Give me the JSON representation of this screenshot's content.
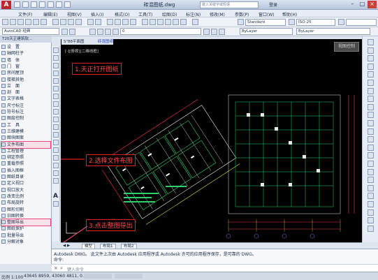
{
  "titlebar": {
    "document_title": "砖混图纸.dwg",
    "search_placeholder": "键入关键字或短语",
    "login_label": "登录",
    "minimize_icon": "minimize-icon",
    "maximize_icon": "maximize-icon",
    "close_icon": "close-icon"
  },
  "menubar": {
    "items": [
      "文件(F)",
      "编辑(E)",
      "视图(V)",
      "插入(I)",
      "格式(O)",
      "工具(T)",
      "绘图(D)",
      "标注(N)",
      "修改(M)",
      "参数(P)",
      "窗口(W)",
      "帮助(H)"
    ]
  },
  "toolbar1": {
    "style_value": "Standard",
    "dim_style_value": "ISO-25"
  },
  "toolbar2": {
    "workspace_value": "AutoCAD 经典",
    "layer_value": "0",
    "color_value": "ByLayer",
    "linetype_value": "ByLayer"
  },
  "left_panel": {
    "title": "T20天正建筑软...",
    "items": [
      "设　置",
      "轴网柱子",
      "墙　体",
      "门　窗",
      "房间屋顶",
      "楼梯其他",
      "立　面",
      "剖　面",
      "文字表格",
      "尺寸标注",
      "符号标注",
      "图层控制",
      "工　具",
      "三维建模",
      "图块图案",
      "文件布图",
      "工程管理",
      "绑定参照",
      "重载参照",
      "插入图框",
      "图纸目录",
      "定义视口",
      "视口放大",
      "改变比例",
      "布局旋转",
      "图形切割",
      "旧图转换",
      "整图导出",
      "图纸保护",
      "批量导出",
      "分解对象"
    ],
    "highlighted": [
      "文件布图",
      "整图导出"
    ]
  },
  "canvas": {
    "drawing_tab_label": "S\"88平面图",
    "drawing_tab_alt": "砖混图纸",
    "view_label": "[-][俯视][二维线框]",
    "view_toggle_label": "视图控制"
  },
  "annotations": [
    {
      "text": "1.天正打开图纸"
    },
    {
      "text": "2.选择文件布图"
    },
    {
      "text": "3.点击整图导出"
    }
  ],
  "layout_tabs": {
    "nav_arrows": "◀ ▶",
    "tabs": [
      "模型",
      "布局1",
      "布局2"
    ],
    "active": "模型"
  },
  "command": {
    "history_line1": "Autodesk DWG。  此文件上次由 Autodesk 应用程序或 Autodesk 许可的应用程序保存，是可靠的 DWG。",
    "history_line2": "命令:",
    "input_placeholder": "键入命令"
  },
  "statusbar": {
    "scale": "比例 1:100",
    "coords": "43645 8959, 43060 4811, 0.0000"
  },
  "colors": {
    "annotation_red": "#e02020",
    "highlight_pink": "#e8457a",
    "canvas_bg": "#000000"
  }
}
